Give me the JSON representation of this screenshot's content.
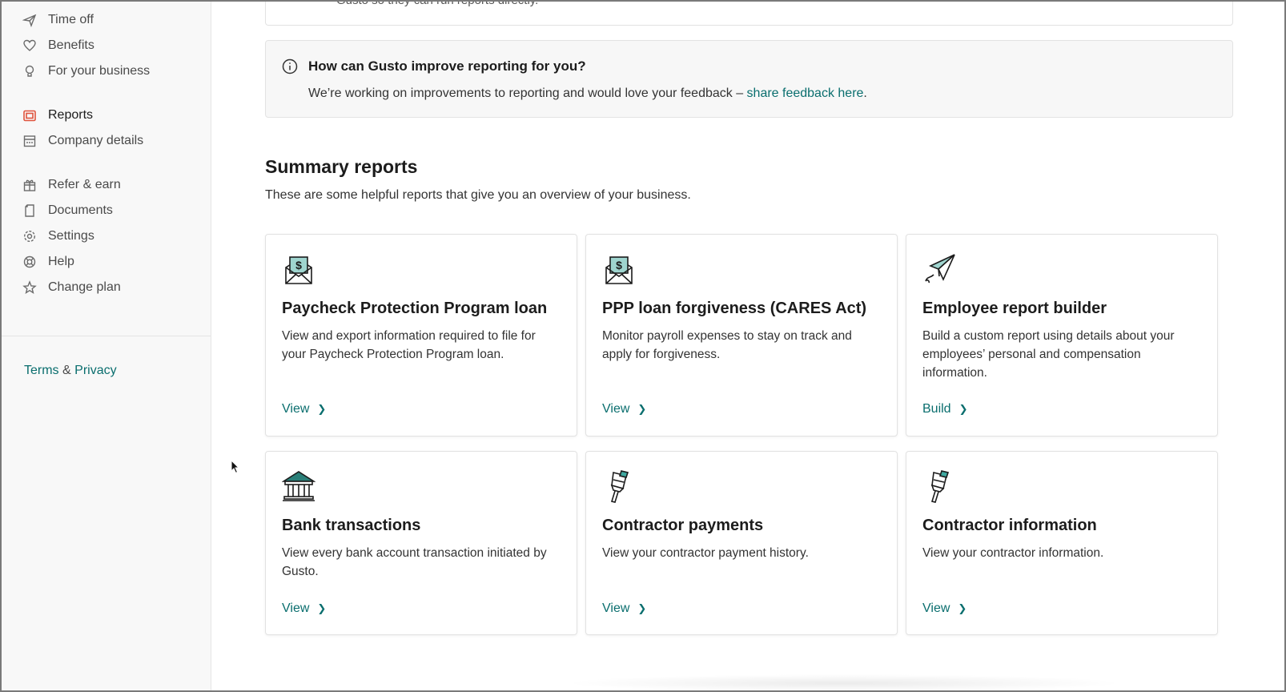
{
  "sidebar": {
    "items": [
      {
        "label": "Time off",
        "icon": "plane-icon",
        "active": false
      },
      {
        "label": "Benefits",
        "icon": "heart-icon",
        "active": false
      },
      {
        "label": "For your business",
        "icon": "lightbulb-icon",
        "active": false
      },
      {
        "label": "Reports",
        "icon": "folder-icon",
        "active": true
      },
      {
        "label": "Company details",
        "icon": "building-icon",
        "active": false
      },
      {
        "label": "Refer & earn",
        "icon": "gift-icon",
        "active": false
      },
      {
        "label": "Documents",
        "icon": "document-icon",
        "active": false
      },
      {
        "label": "Settings",
        "icon": "gear-icon",
        "active": false
      },
      {
        "label": "Help",
        "icon": "lifebuoy-icon",
        "active": false
      },
      {
        "label": "Change plan",
        "icon": "star-icon",
        "active": false
      }
    ],
    "terms": "Terms",
    "ampersand": "&",
    "privacy": "Privacy"
  },
  "top_card": {
    "text": "Gusto so they can run reports directly."
  },
  "feedback": {
    "title": "How can Gusto improve reporting for you?",
    "text": "We’re working on improvements to reporting and would love your feedback – ",
    "link": "share feedback here",
    "suffix": "."
  },
  "summary": {
    "title": "Summary reports",
    "subtitle": "These are some helpful reports that give you an overview of your business."
  },
  "cards": [
    {
      "title": "Paycheck Protection Program loan",
      "description": "View and export information required to file for your Paycheck Protection Program loan.",
      "link": "View",
      "icon": "money-envelope-icon"
    },
    {
      "title": "PPP loan forgiveness (CARES Act)",
      "description": "Monitor payroll expenses to stay on track and apply for forgiveness.",
      "link": "View",
      "icon": "money-envelope-icon"
    },
    {
      "title": "Employee report builder",
      "description": "Build a custom report using details about your employees’ personal and compensation information.",
      "link": "Build",
      "icon": "paper-plane-icon"
    },
    {
      "title": "Bank transactions",
      "description": "View every bank account transaction initiated by Gusto.",
      "link": "View",
      "icon": "bank-icon"
    },
    {
      "title": "Contractor payments",
      "description": "View your contractor payment history.",
      "link": "View",
      "icon": "paintbrush-icon"
    },
    {
      "title": "Contractor information",
      "description": "View your contractor information.",
      "link": "View",
      "icon": "paintbrush-icon"
    }
  ],
  "colors": {
    "accent": "#0a6e6e",
    "active_icon": "#e0533d",
    "teal_icon": "#3fa8a0"
  }
}
